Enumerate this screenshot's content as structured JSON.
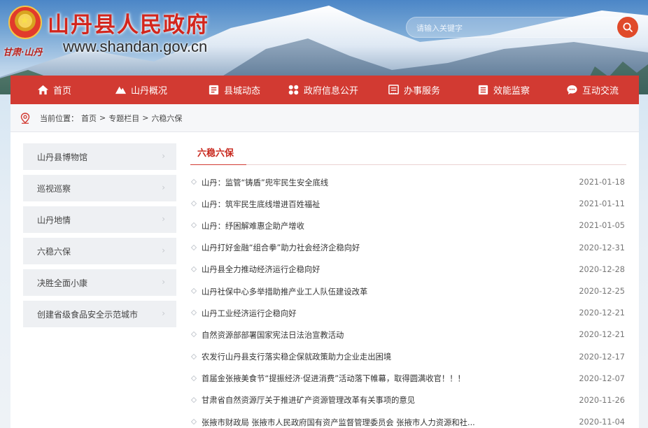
{
  "header": {
    "title": "山丹县人民政府",
    "sub": "甘肃·山丹",
    "url": "www.shandan.gov.cn"
  },
  "search": {
    "placeholder": "请输入关键字",
    "button_icon": "search-icon"
  },
  "nav": {
    "items": [
      {
        "label": "首页",
        "icon": "home-icon"
      },
      {
        "label": "山丹概况",
        "icon": "mountain-icon"
      },
      {
        "label": "县城动态",
        "icon": "news-icon"
      },
      {
        "label": "政府信息公开",
        "icon": "grid-icon"
      },
      {
        "label": "办事服务",
        "icon": "form-icon"
      },
      {
        "label": "效能监察",
        "icon": "doc-icon"
      },
      {
        "label": "互动交流",
        "icon": "chat-icon"
      }
    ]
  },
  "breadcrumb": {
    "prefix": "当前位置：",
    "home": "首页",
    "sep": ">",
    "level1": "专题栏目",
    "current": "六稳六保"
  },
  "sidebar": {
    "items": [
      {
        "label": "山丹县博物馆"
      },
      {
        "label": "巡视巡察"
      },
      {
        "label": "山丹地情"
      },
      {
        "label": "六稳六保"
      },
      {
        "label": "决胜全面小康"
      },
      {
        "label": "创建省级食品安全示范城市"
      }
    ]
  },
  "content": {
    "title": "六稳六保",
    "articles": [
      {
        "title": "山丹：监管“铸盾”兜牢民生安全底线",
        "date": "2021-01-18"
      },
      {
        "title": "山丹：筑牢民生底线增进百姓福祉",
        "date": "2021-01-11"
      },
      {
        "title": "山丹：纾困解难惠企助产增收",
        "date": "2021-01-05"
      },
      {
        "title": "山丹打好金融“组合拳”助力社会经济企稳向好",
        "date": "2020-12-31"
      },
      {
        "title": "山丹县全力推动经济运行企稳向好",
        "date": "2020-12-28"
      },
      {
        "title": "山丹社保中心多举措助推产业工人队伍建设改革",
        "date": "2020-12-25"
      },
      {
        "title": "山丹工业经济运行企稳向好",
        "date": "2020-12-21"
      },
      {
        "title": "自然资源部部署国家宪法日法治宣教活动",
        "date": "2020-12-21"
      },
      {
        "title": "农发行山丹县支行落实稳企保就政策助力企业走出困境",
        "date": "2020-12-17"
      },
      {
        "title": "首届金张掖美食节“提振经济·促进消费”活动落下帷幕，取得圆满收官！！！",
        "date": "2020-12-07"
      },
      {
        "title": "甘肃省自然资源厅关于推进矿产资源管理改革有关事项的意见",
        "date": "2020-11-26"
      },
      {
        "title": "张掖市财政局 张掖市人民政府国有资产监督管理委员会 张掖市人力资源和社...",
        "date": "2020-11-04"
      }
    ]
  },
  "colors": {
    "nav_bg": "#d23a32",
    "accent": "#c8281e",
    "search_btn": "#e04a2a"
  }
}
